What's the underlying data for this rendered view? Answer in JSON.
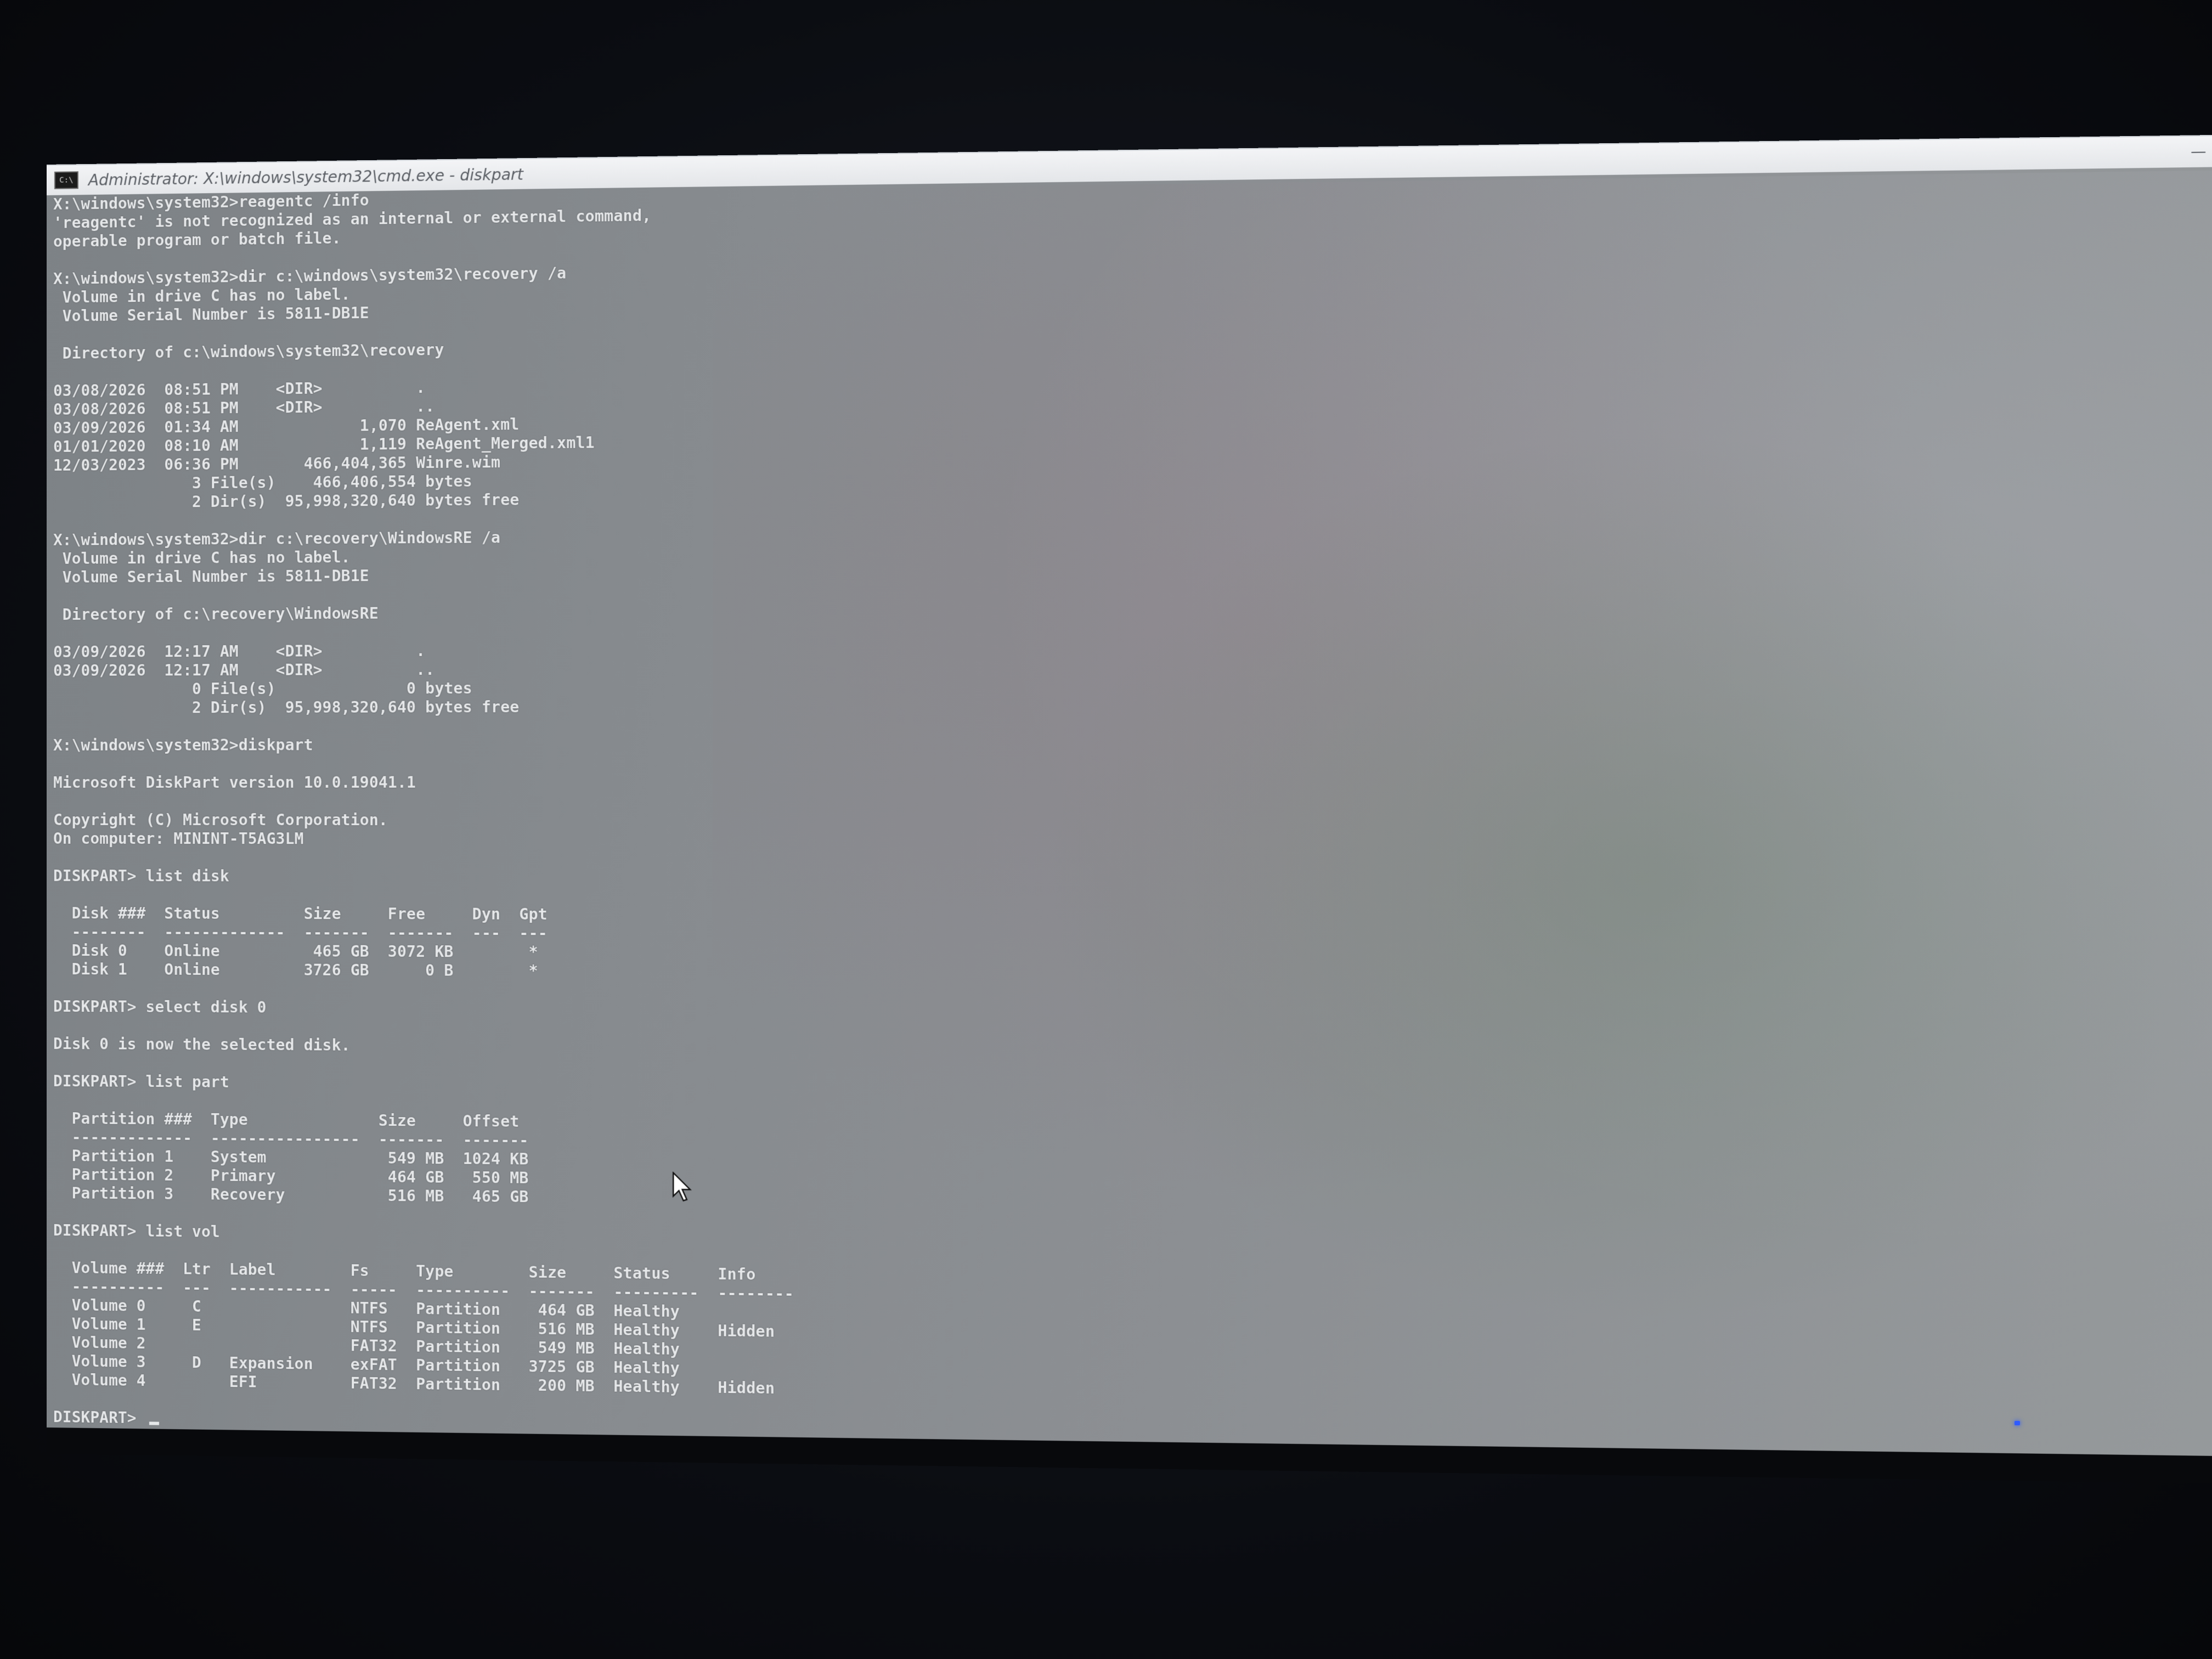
{
  "window": {
    "title": "Administrator: X:\\windows\\system32\\cmd.exe - diskpart",
    "icon_label": "C:\\",
    "minimize_glyph": "—",
    "maximize_glyph": "☐",
    "close_glyph": "✕"
  },
  "console": {
    "lines": [
      "X:\\windows\\system32>reagentc /info",
      "'reagentc' is not recognized as an internal or external command,",
      "operable program or batch file.",
      "",
      "X:\\windows\\system32>dir c:\\windows\\system32\\recovery /a",
      " Volume in drive C has no label.",
      " Volume Serial Number is 5811-DB1E",
      "",
      " Directory of c:\\windows\\system32\\recovery",
      "",
      "03/08/2026  08:51 PM    <DIR>          .",
      "03/08/2026  08:51 PM    <DIR>          ..",
      "03/09/2026  01:34 AM             1,070 ReAgent.xml",
      "01/01/2020  08:10 AM             1,119 ReAgent_Merged.xml1",
      "12/03/2023  06:36 PM       466,404,365 Winre.wim",
      "               3 File(s)    466,406,554 bytes",
      "               2 Dir(s)  95,998,320,640 bytes free",
      "",
      "X:\\windows\\system32>dir c:\\recovery\\WindowsRE /a",
      " Volume in drive C has no label.",
      " Volume Serial Number is 5811-DB1E",
      "",
      " Directory of c:\\recovery\\WindowsRE",
      "",
      "03/09/2026  12:17 AM    <DIR>          .",
      "03/09/2026  12:17 AM    <DIR>          ..",
      "               0 File(s)              0 bytes",
      "               2 Dir(s)  95,998,320,640 bytes free",
      "",
      "X:\\windows\\system32>diskpart",
      "",
      "Microsoft DiskPart version 10.0.19041.1",
      "",
      "Copyright (C) Microsoft Corporation.",
      "On computer: MININT-T5AG3LM",
      "",
      "DISKPART> list disk",
      "",
      "  Disk ###  Status         Size     Free     Dyn  Gpt",
      "  --------  -------------  -------  -------  ---  ---",
      "  Disk 0    Online          465 GB  3072 KB        *",
      "  Disk 1    Online         3726 GB      0 B        *",
      "",
      "DISKPART> select disk 0",
      "",
      "Disk 0 is now the selected disk.",
      "",
      "DISKPART> list part",
      "",
      "  Partition ###  Type              Size     Offset",
      "  -------------  ----------------  -------  -------",
      "  Partition 1    System             549 MB  1024 KB",
      "  Partition 2    Primary            464 GB   550 MB",
      "  Partition 3    Recovery           516 MB   465 GB",
      "",
      "DISKPART> list vol",
      "",
      "  Volume ###  Ltr  Label        Fs     Type        Size     Status     Info",
      "  ----------  ---  -----------  -----  ----------  -------  ---------  --------",
      "  Volume 0     C                NTFS   Partition    464 GB  Healthy",
      "  Volume 1     E                NTFS   Partition    516 MB  Healthy    Hidden",
      "  Volume 2                      FAT32  Partition    549 MB  Healthy",
      "  Volume 3     D   Expansion    exFAT  Partition   3725 GB  Healthy",
      "  Volume 4         EFI          FAT32  Partition    200 MB  Healthy    Hidden",
      ""
    ],
    "prompt": "DISKPART> "
  },
  "scrollbar": {
    "up_glyph": "▲",
    "down_glyph": "▼"
  },
  "colors": {
    "console_text": "#e6e8ea",
    "console_bg": "#878b8f",
    "titlebar_bg": "#f0f1f3",
    "close_button": "#c42b1c"
  }
}
